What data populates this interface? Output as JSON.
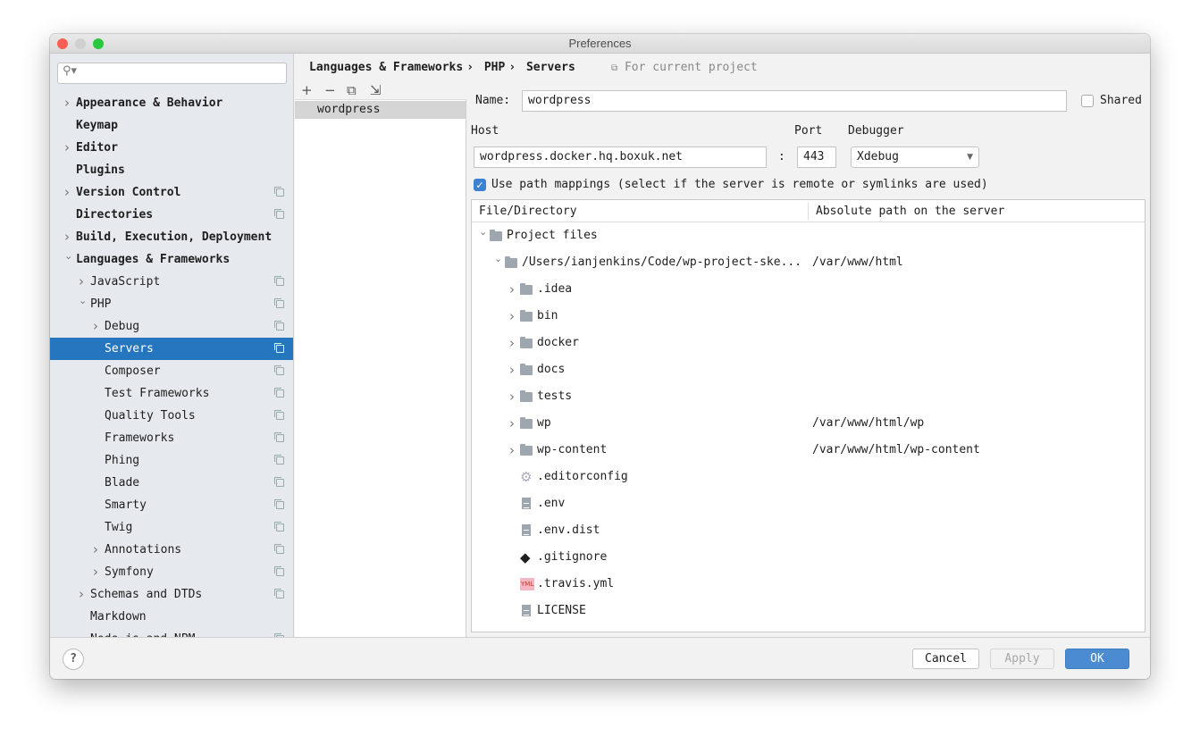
{
  "window": {
    "title": "Preferences"
  },
  "search": {
    "placeholder": ""
  },
  "sidebar": {
    "items": [
      {
        "label": "Appearance & Behavior",
        "level": 0,
        "arrow": "collapsed",
        "bold": true,
        "copy": false
      },
      {
        "label": "Keymap",
        "level": 0,
        "arrow": "none",
        "bold": true,
        "copy": false
      },
      {
        "label": "Editor",
        "level": 0,
        "arrow": "collapsed",
        "bold": true,
        "copy": false
      },
      {
        "label": "Plugins",
        "level": 0,
        "arrow": "none",
        "bold": true,
        "copy": false
      },
      {
        "label": "Version Control",
        "level": 0,
        "arrow": "collapsed",
        "bold": true,
        "copy": true
      },
      {
        "label": "Directories",
        "level": 0,
        "arrow": "none",
        "bold": true,
        "copy": true
      },
      {
        "label": "Build, Execution, Deployment",
        "level": 0,
        "arrow": "collapsed",
        "bold": true,
        "copy": false
      },
      {
        "label": "Languages & Frameworks",
        "level": 0,
        "arrow": "expanded",
        "bold": true,
        "copy": false
      },
      {
        "label": "JavaScript",
        "level": 1,
        "arrow": "collapsed",
        "bold": false,
        "copy": true
      },
      {
        "label": "PHP",
        "level": 1,
        "arrow": "expanded",
        "bold": false,
        "copy": true
      },
      {
        "label": "Debug",
        "level": 2,
        "arrow": "collapsed",
        "bold": false,
        "copy": true
      },
      {
        "label": "Servers",
        "level": 2,
        "arrow": "none",
        "bold": false,
        "copy": true,
        "selected": true
      },
      {
        "label": "Composer",
        "level": 2,
        "arrow": "none",
        "bold": false,
        "copy": true
      },
      {
        "label": "Test Frameworks",
        "level": 2,
        "arrow": "none",
        "bold": false,
        "copy": true
      },
      {
        "label": "Quality Tools",
        "level": 2,
        "arrow": "none",
        "bold": false,
        "copy": true
      },
      {
        "label": "Frameworks",
        "level": 2,
        "arrow": "none",
        "bold": false,
        "copy": true
      },
      {
        "label": "Phing",
        "level": 2,
        "arrow": "none",
        "bold": false,
        "copy": true
      },
      {
        "label": "Blade",
        "level": 2,
        "arrow": "none",
        "bold": false,
        "copy": true
      },
      {
        "label": "Smarty",
        "level": 2,
        "arrow": "none",
        "bold": false,
        "copy": true
      },
      {
        "label": "Twig",
        "level": 2,
        "arrow": "none",
        "bold": false,
        "copy": true
      },
      {
        "label": "Annotations",
        "level": 2,
        "arrow": "collapsed",
        "bold": false,
        "copy": true
      },
      {
        "label": "Symfony",
        "level": 2,
        "arrow": "collapsed",
        "bold": false,
        "copy": true
      },
      {
        "label": "Schemas and DTDs",
        "level": 1,
        "arrow": "collapsed",
        "bold": false,
        "copy": true
      },
      {
        "label": "Markdown",
        "level": 1,
        "arrow": "none",
        "bold": false,
        "copy": false
      },
      {
        "label": "Node.js and NPM",
        "level": 1,
        "arrow": "none",
        "bold": false,
        "copy": true
      }
    ]
  },
  "breadcrumb": [
    "Languages & Frameworks",
    "PHP",
    "Servers"
  ],
  "breadcrumb_sep": "›",
  "scope_note": "For current project",
  "servers_toolbar": {
    "add": "+",
    "remove": "−"
  },
  "servers": [
    "wordpress"
  ],
  "form": {
    "name_label": "Name:",
    "name_value": "wordpress",
    "shared_label": "Shared",
    "shared": false,
    "host_label": "Host",
    "host_value": "wordpress.docker.hq.boxuk.net",
    "colon": ":",
    "port_label": "Port",
    "port_value": "443",
    "debugger_label": "Debugger",
    "debugger_value": "Xdebug",
    "mappings_checked": true,
    "mappings_label": "Use path mappings (select if the server is remote or symlinks are used)"
  },
  "mappings": {
    "columns": [
      "File/Directory",
      "Absolute path on the server"
    ],
    "rows": [
      {
        "name": "Project files",
        "level": 0,
        "arrow": "expanded",
        "icon": "folder",
        "path": ""
      },
      {
        "name": "/Users/ianjenkins/Code/wp-project-ske...",
        "level": 1,
        "arrow": "expanded",
        "icon": "folder",
        "path": "/var/www/html"
      },
      {
        "name": ".idea",
        "level": 2,
        "arrow": "collapsed",
        "icon": "folder",
        "path": ""
      },
      {
        "name": "bin",
        "level": 2,
        "arrow": "collapsed",
        "icon": "folder",
        "path": ""
      },
      {
        "name": "docker",
        "level": 2,
        "arrow": "collapsed",
        "icon": "folder",
        "path": ""
      },
      {
        "name": "docs",
        "level": 2,
        "arrow": "collapsed",
        "icon": "folder",
        "path": ""
      },
      {
        "name": "tests",
        "level": 2,
        "arrow": "collapsed",
        "icon": "folder",
        "path": ""
      },
      {
        "name": "wp",
        "level": 2,
        "arrow": "collapsed",
        "icon": "folder",
        "path": "/var/www/html/wp"
      },
      {
        "name": "wp-content",
        "level": 2,
        "arrow": "collapsed",
        "icon": "folder",
        "path": "/var/www/html/wp-content"
      },
      {
        "name": ".editorconfig",
        "level": 2,
        "arrow": "none",
        "icon": "gear",
        "path": ""
      },
      {
        "name": ".env",
        "level": 2,
        "arrow": "none",
        "icon": "text-file",
        "path": ""
      },
      {
        "name": ".env.dist",
        "level": 2,
        "arrow": "none",
        "icon": "text-file",
        "path": ""
      },
      {
        "name": ".gitignore",
        "level": 2,
        "arrow": "none",
        "icon": "git",
        "path": ""
      },
      {
        "name": ".travis.yml",
        "level": 2,
        "arrow": "none",
        "icon": "yml",
        "path": ""
      },
      {
        "name": "LICENSE",
        "level": 2,
        "arrow": "none",
        "icon": "text-file",
        "path": ""
      }
    ]
  },
  "footer": {
    "help": "?",
    "cancel": "Cancel",
    "apply": "Apply",
    "ok": "OK"
  },
  "colors": {
    "accent": "#2675bf",
    "ok_button": "#4a8bd1",
    "sidebar_bg": "#e6eaef"
  },
  "yml_badge": "YML"
}
